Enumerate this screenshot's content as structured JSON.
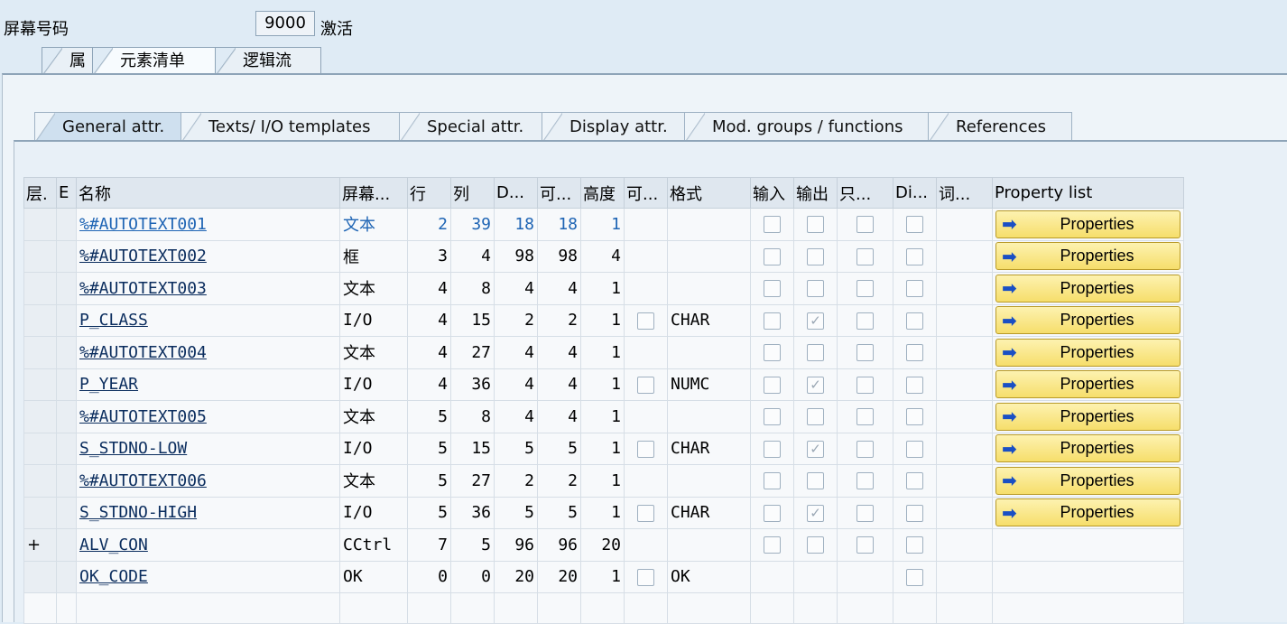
{
  "header": {
    "screen_label": "屏幕号码",
    "screen_number": "9000",
    "status": "激活"
  },
  "outer_tabs": [
    {
      "label": "属性"
    },
    {
      "label": "元素清单"
    },
    {
      "label": "逻辑流"
    }
  ],
  "inner_tabs": [
    {
      "label": "General attr."
    },
    {
      "label": "Texts/ I/O templates"
    },
    {
      "label": "Special attr."
    },
    {
      "label": "Display attr."
    },
    {
      "label": "Mod. groups / functions"
    },
    {
      "label": "References"
    }
  ],
  "grid": {
    "columns": [
      "层.",
      "E",
      "名称",
      "屏幕...",
      "行",
      "列",
      "D...",
      "可...",
      "高度",
      "可...",
      "格式",
      "输入",
      "输出",
      "只...",
      "Di...",
      "词...",
      "Property list"
    ],
    "property_button_label": "Properties",
    "rows": [
      {
        "level": "",
        "name": "%#AUTOTEXT001",
        "type": "文本",
        "row": "2",
        "col": "39",
        "dlen": "18",
        "vlen": "18",
        "height": "1",
        "fmt": "",
        "out": false,
        "props": true,
        "selected": true
      },
      {
        "level": "",
        "name": "%#AUTOTEXT002",
        "type": "框",
        "row": "3",
        "col": "4",
        "dlen": "98",
        "vlen": "98",
        "height": "4",
        "fmt": "",
        "out": false,
        "props": true
      },
      {
        "level": "",
        "name": "%#AUTOTEXT003",
        "type": "文本",
        "row": "4",
        "col": "8",
        "dlen": "4",
        "vlen": "4",
        "height": "1",
        "fmt": "",
        "out": false,
        "props": true
      },
      {
        "level": "",
        "name": "P_CLASS",
        "type": "I/O",
        "row": "4",
        "col": "15",
        "dlen": "2",
        "vlen": "2",
        "height": "1",
        "fmt": "CHAR",
        "out": true,
        "props": true
      },
      {
        "level": "",
        "name": "%#AUTOTEXT004",
        "type": "文本",
        "row": "4",
        "col": "27",
        "dlen": "4",
        "vlen": "4",
        "height": "1",
        "fmt": "",
        "out": false,
        "props": true
      },
      {
        "level": "",
        "name": "P_YEAR",
        "type": "I/O",
        "row": "4",
        "col": "36",
        "dlen": "4",
        "vlen": "4",
        "height": "1",
        "fmt": "NUMC",
        "out": true,
        "props": true
      },
      {
        "level": "",
        "name": "%#AUTOTEXT005",
        "type": "文本",
        "row": "5",
        "col": "8",
        "dlen": "4",
        "vlen": "4",
        "height": "1",
        "fmt": "",
        "out": false,
        "props": true
      },
      {
        "level": "",
        "name": "S_STDNO-LOW",
        "type": "I/O",
        "row": "5",
        "col": "15",
        "dlen": "5",
        "vlen": "5",
        "height": "1",
        "fmt": "CHAR",
        "out": true,
        "props": true
      },
      {
        "level": "",
        "name": "%#AUTOTEXT006",
        "type": "文本",
        "row": "5",
        "col": "27",
        "dlen": "2",
        "vlen": "2",
        "height": "1",
        "fmt": "",
        "out": false,
        "props": true
      },
      {
        "level": "",
        "name": "S_STDNO-HIGH",
        "type": "I/O",
        "row": "5",
        "col": "36",
        "dlen": "5",
        "vlen": "5",
        "height": "1",
        "fmt": "CHAR",
        "out": true,
        "props": true
      },
      {
        "level": "+",
        "name": "ALV_CON",
        "type": "CCtrl",
        "row": "7",
        "col": "5",
        "dlen": "96",
        "vlen": "96",
        "height": "20",
        "fmt": "",
        "out": false,
        "props": false
      },
      {
        "level": "",
        "name": "OK_CODE",
        "type": "OK",
        "row": "0",
        "col": "0",
        "dlen": "20",
        "vlen": "20",
        "height": "1",
        "fmt": "OK",
        "out": false,
        "props": false,
        "ok": true
      }
    ]
  }
}
